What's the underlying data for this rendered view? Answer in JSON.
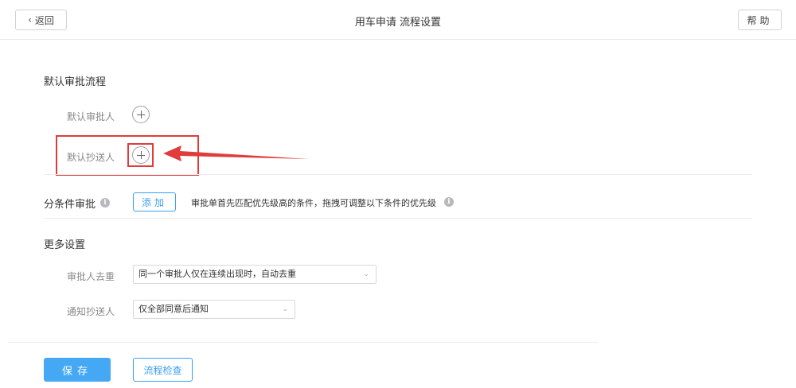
{
  "header": {
    "back_label": "返回",
    "title": "用车申请 流程设置",
    "help_label": "帮助"
  },
  "default_flow": {
    "section_title": "默认审批流程",
    "approver_label": "默认审批人",
    "cc_label": "默认抄送人"
  },
  "conditional": {
    "label": "分条件审批",
    "add_label": "添加",
    "hint": "审批单首先匹配优先级高的条件，拖拽可调整以下条件的优先级"
  },
  "more_settings": {
    "section_title": "更多设置",
    "dedupe_label": "审批人去重",
    "dedupe_value": "同一个审批人仅在连续出现时，自动去重",
    "notify_label": "通知抄送人",
    "notify_value": "仅全部同意后通知"
  },
  "footer": {
    "save_label": "保存",
    "check_label": "流程检查"
  },
  "colors": {
    "accent": "#45a8f5",
    "highlight": "#e23b3b"
  },
  "icons": [
    "chevron-left-icon",
    "plus-circle-icon",
    "info-icon",
    "chevron-down-icon",
    "arrow-annotation"
  ]
}
